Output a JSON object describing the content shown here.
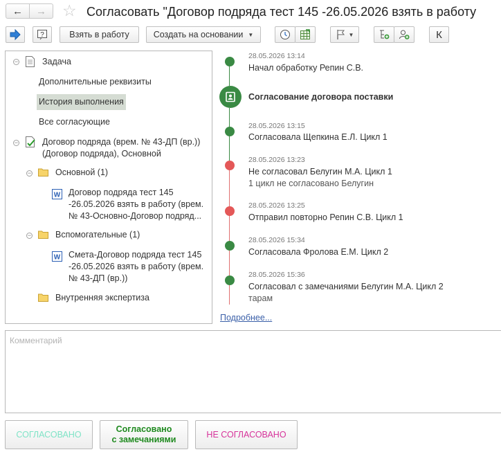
{
  "window": {
    "title": "Согласовать \"Договор подряда тест 145 -26.05.2026 взять в работу"
  },
  "toolbar": {
    "take_to_work": "Взять в работу",
    "create_based_on": "Создать на основании",
    "font_button": "К"
  },
  "tree": {
    "task": "Задача",
    "additional_details": "Дополнительные реквизиты",
    "execution_history": "История выполнения",
    "all_approvers": "Все согласующие",
    "contract_line1": "Договор подряда (врем. № 43-ДП (вр.))",
    "contract_line2": "(Договор подряда), Основной",
    "folder_main": "Основной (1)",
    "main_file_line1": "Договор подряда тест 145",
    "main_file_line2": "-26.05.2026 взять в работу (врем.",
    "main_file_line3": "№ 43-Основно-Договор подряд...",
    "folder_aux": "Вспомогательные (1)",
    "aux_file_line1": "Смета-Договор подряда тест 145",
    "aux_file_line2": "-26.05.2026 взять в работу (врем.",
    "aux_file_line3": "№ 43-ДП (вр.))",
    "folder_expertise": "Внутренняя экспертиза"
  },
  "timeline": {
    "events": [
      {
        "time": "28.05.2026 13:14",
        "text": "Начал обработку Репин С.В.",
        "note": "",
        "status": "green"
      },
      {
        "time": "",
        "text": "Согласование договора поставки",
        "note": "",
        "status": "stage"
      },
      {
        "time": "28.05.2026 13:15",
        "text": "Согласовала Щепкина Е.Л. Цикл 1",
        "note": "",
        "status": "green"
      },
      {
        "time": "28.05.2026 13:23",
        "text": "Не согласовал Белугин М.А. Цикл 1",
        "note": "1 цикл не согласовано Белугин",
        "status": "red"
      },
      {
        "time": "28.05.2026 13:25",
        "text": "Отправил повторно Репин С.В. Цикл 1",
        "note": "",
        "status": "red"
      },
      {
        "time": "28.05.2026 15:34",
        "text": "Согласовала Фролова Е.М. Цикл 2",
        "note": "",
        "status": "green"
      },
      {
        "time": "28.05.2026 15:36",
        "text": "Согласовал с замечаниями Белугин М.А. Цикл 2",
        "note": "тарам",
        "status": "green"
      }
    ],
    "more_link": "Подробнее..."
  },
  "comment": {
    "placeholder": "Комментарий"
  },
  "actions": {
    "approved": "СОГЛАСОВАНО",
    "approved_remarks_line1": "Согласовано",
    "approved_remarks_line2": "с замечаниями",
    "not_approved": "НЕ СОГЛАСОВАНО"
  },
  "colors": {
    "approved_text": "#7fe3c6",
    "remarks_text": "#1f8a1f",
    "not_approved_text": "#d6339a",
    "green_dot": "#3a8a44",
    "red_dot": "#e45858",
    "link": "#3a5fa8",
    "selection": "#d5dcd3"
  },
  "icons": {
    "back": "arrow-left-icon",
    "forward": "arrow-right-icon",
    "favorite": "star-icon",
    "go": "go-arrow-icon",
    "help": "help-icon",
    "clock": "clock-icon",
    "spreadsheet": "spreadsheet-icon",
    "flag": "flag-icon",
    "tree_add": "tree-add-icon",
    "user_add": "user-add-icon",
    "document": "document-icon",
    "document_check": "document-check-icon",
    "folder": "folder-icon",
    "word": "word-file-icon",
    "stage": "approval-stage-icon"
  }
}
